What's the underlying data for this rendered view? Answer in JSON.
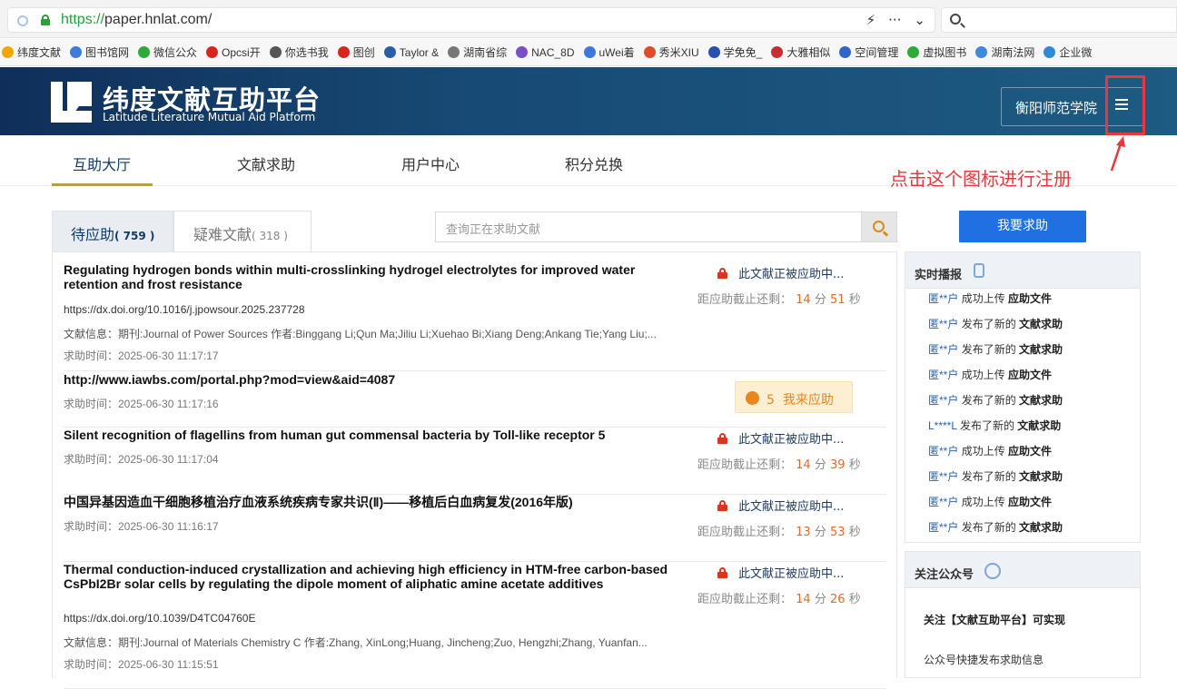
{
  "browser": {
    "url_scheme": "https://",
    "url_rest": "paper.hnlat.com/",
    "bookmarks": [
      {
        "label": "纬度文献",
        "color": "#f0a800"
      },
      {
        "label": "图书馆网",
        "color": "#3f7ad9"
      },
      {
        "label": "微信公众",
        "color": "#2faa3a"
      },
      {
        "label": "Opcsi开",
        "color": "#d8261c"
      },
      {
        "label": "你选书我",
        "color": "#555555"
      },
      {
        "label": "图创",
        "color": "#d8261c"
      },
      {
        "label": "Taylor &",
        "color": "#2b5ea8"
      },
      {
        "label": "湖南省综",
        "color": "#777777"
      },
      {
        "label": "NAC_8D",
        "color": "#7a4fc4"
      },
      {
        "label": "uWei着",
        "color": "#3f7ad9"
      },
      {
        "label": "秀米XIU",
        "color": "#e04b2a"
      },
      {
        "label": "学免免_",
        "color": "#2a4fb0"
      },
      {
        "label": "大雅相似",
        "color": "#c72f2f"
      },
      {
        "label": "空间管理",
        "color": "#2f65c8"
      },
      {
        "label": "虚拟图书",
        "color": "#2faa3a"
      },
      {
        "label": "湖南法网",
        "color": "#3f8ad9"
      },
      {
        "label": "企业微",
        "color": "#2f8ad9"
      }
    ]
  },
  "header": {
    "title": "纬度文献互助平台",
    "subtitle": "Latitude Literature Mutual Aid Platform",
    "school": "衡阳师范学院"
  },
  "nav": {
    "items": [
      "互助大厅",
      "文献求助",
      "用户中心",
      "积分兑换"
    ]
  },
  "annotation": "点击这个图标进行注册",
  "tabs": [
    {
      "label": "待应助",
      "count": "( 759 )"
    },
    {
      "label": "疑难文献",
      "count": "( 318 )"
    }
  ],
  "search": {
    "placeholder": "查询正在求助文献"
  },
  "help_button": "我要求助",
  "labels": {
    "countdown_prefix": "距应助截止还剩：",
    "min": "分",
    "sec": "秒",
    "in_progress": "此文献正被应助中...",
    "answer": "我来应助"
  },
  "items": [
    {
      "title": "Regulating hydrogen bonds within multi-crosslinking hydrogel electrolytes for improved water retention and frost resistance",
      "url": "https://dx.doi.org/10.1016/j.jpowsour.2025.237728",
      "info": "文献信息：期刊:Journal of Power Sources 作者:Binggang Li;Qun Ma;Jiliu Li;Xuehao Bi;Xiang Deng;Ankang Tie;Yang Liu;...",
      "time": "求助时间：2025-06-30 11:17:17",
      "status": "locked",
      "min": "14",
      "sec": "51"
    },
    {
      "title": "http://www.iawbs.com/portal.php?mod=view&aid=4087",
      "time": "求助时间：2025-06-30 11:17:16",
      "status": "open",
      "reward": "5"
    },
    {
      "title": "Silent recognition of flagellins from human gut commensal bacteria by Toll-like receptor 5",
      "time": "求助时间：2025-06-30 11:17:04",
      "status": "locked",
      "min": "14",
      "sec": "39"
    },
    {
      "title": "中国异基因造血干细胞移植治疗血液系统疾病专家共识(Ⅱ)——移植后白血病复发(2016年版)",
      "time": "求助时间：2025-06-30 11:16:17",
      "status": "locked",
      "min": "13",
      "sec": "53"
    },
    {
      "title": "Thermal conduction-induced crystallization and achieving high efficiency in HTM-free carbon-based CsPbI2Br solar cells by regulating the dipole moment of aliphatic amine acetate additives",
      "url": "https://dx.doi.org/10.1039/D4TC04760E",
      "info": "文献信息：期刊:Journal of Materials Chemistry C 作者:Zhang, XinLong;Huang, Jincheng;Zuo, Hengzhi;Zhang, Yuanfan...",
      "time": "求助时间：2025-06-30 11:15:51",
      "status": "locked",
      "min": "14",
      "sec": "26"
    }
  ],
  "broadcast": {
    "title": "实时播报",
    "entries": [
      {
        "user": "匿**户",
        "verb": "成功上传",
        "obj": "应助文件"
      },
      {
        "user": "匿**户",
        "verb": "发布了新的",
        "obj": "文献求助"
      },
      {
        "user": "匿**户",
        "verb": "发布了新的",
        "obj": "文献求助"
      },
      {
        "user": "匿**户",
        "verb": "成功上传",
        "obj": "应助文件"
      },
      {
        "user": "匿**户",
        "verb": "发布了新的",
        "obj": "文献求助"
      },
      {
        "user": "L****L",
        "verb": "发布了新的",
        "obj": "文献求助"
      },
      {
        "user": "匿**户",
        "verb": "成功上传",
        "obj": "应助文件"
      },
      {
        "user": "匿**户",
        "verb": "发布了新的",
        "obj": "文献求助"
      },
      {
        "user": "匿**户",
        "verb": "成功上传",
        "obj": "应助文件"
      },
      {
        "user": "匿**户",
        "verb": "发布了新的",
        "obj": "文献求助"
      }
    ]
  },
  "follow": {
    "title": "关注公众号",
    "line1": "关注【文献互助平台】可实现",
    "line2": "公众号快捷发布求助信息"
  }
}
